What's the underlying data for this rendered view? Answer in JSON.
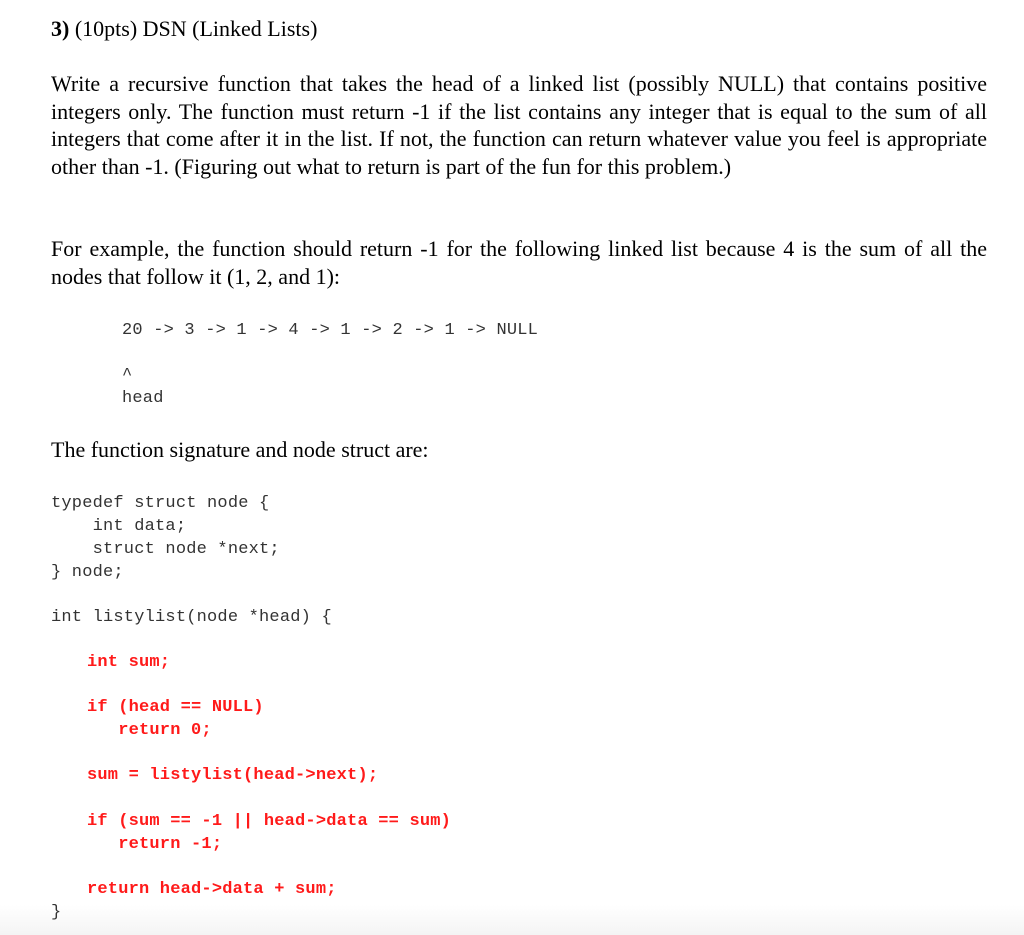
{
  "question": {
    "number": "3)",
    "title_rest": " (10pts) DSN (Linked Lists)",
    "paragraph_1": "Write a recursive function that takes the head of a linked list (possibly NULL) that contains positive integers only. The function must return -1 if the list contains any integer that is equal to the sum of all integers that come after it in the list. If not, the function can return whatever value you feel is appropriate other than -1. (Figuring out what to return is part of the fun for this problem.)",
    "paragraph_2": "For example, the function should return -1 for the following linked list because 4 is the sum of all the nodes that follow it (1, 2, and 1):",
    "example_list": "20 -> 3 -> 1 -> 4 -> 1 -> 2 -> 1 -> NULL",
    "example_caret": "^",
    "example_head_label": "head",
    "paragraph_3": "The function signature and node struct are:"
  },
  "code": {
    "struct_lines": [
      "typedef struct node {",
      "    int data;",
      "    struct node *next;",
      "} node;"
    ],
    "signature": "int listylist(node *head) {",
    "closing_brace": "}"
  },
  "answer": {
    "color": "#ff1a1a",
    "lines": [
      "int sum;",
      "if (head == NULL)",
      "   return 0;",
      "sum = listylist(head->next);",
      "if (sum == -1 || head->data == sum)",
      "   return -1;",
      "return head->data + sum;"
    ]
  }
}
